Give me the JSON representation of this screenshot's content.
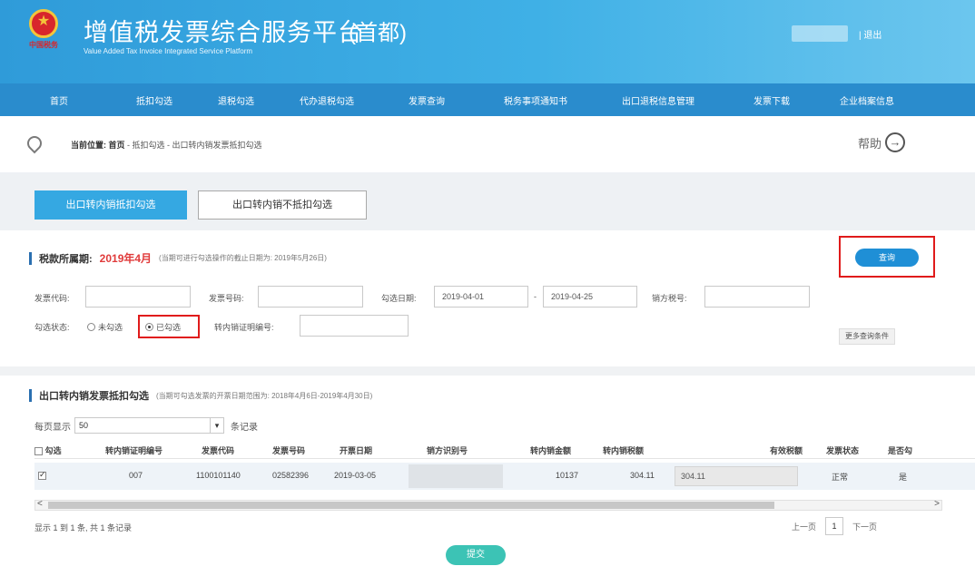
{
  "header": {
    "title": "增值税发票综合服务平台",
    "subtitle": "Value Added Tax Invoice Integrated Service Platform",
    "region": "(首都)",
    "logout": "| 退出",
    "emblem_caption": "中国税务"
  },
  "nav": {
    "items": [
      {
        "label": "首页"
      },
      {
        "label": "抵扣勾选"
      },
      {
        "label": "退税勾选"
      },
      {
        "label": "代办退税勾选"
      },
      {
        "label": "发票查询"
      },
      {
        "label": "税务事项通知书"
      },
      {
        "label": "出口退税信息管理"
      },
      {
        "label": "发票下载"
      },
      {
        "label": "企业档案信息"
      }
    ]
  },
  "breadcrumb": {
    "prefix": "当前位置:",
    "home": "首页",
    "path": " - 抵扣勾选 - 出口转内销发票抵扣勾选"
  },
  "help": {
    "label": "帮助",
    "arrow": "→"
  },
  "tabs": {
    "active": "出口转内销抵扣勾选",
    "inactive": "出口转内销不抵扣勾选"
  },
  "filter": {
    "period_label": "税款所属期:",
    "period_value": "2019年4月",
    "period_hint": "(当期可进行勾选操作的截止日期为: 2019年5月26日)",
    "query_button": "查询",
    "invoice_code_label": "发票代码:",
    "invoice_code_value": "",
    "invoice_no_label": "发票号码:",
    "invoice_no_value": "",
    "select_date_label": "勾选日期:",
    "date_from": "2019-04-01",
    "date_sep": "-",
    "date_to": "2019-04-25",
    "seller_tax_label": "销方税号:",
    "seller_tax_value": "",
    "status_label": "勾选状态:",
    "status_unselected": "未勾选",
    "status_selected": "已勾选",
    "cert_no_label": "转内销证明编号:",
    "cert_no_value": "",
    "more_conditions": "更多查询条件"
  },
  "results": {
    "title": "出口转内销发票抵扣勾选",
    "hint": "(当期可勾选发票的开票日期范围为: 2018年4月6日-2019年4月30日)",
    "per_page_label": "每页显示",
    "per_page_value": "50",
    "per_page_suffix": "条记录",
    "columns": [
      "勾选",
      "转内销证明编号",
      "发票代码",
      "发票号码",
      "开票日期",
      "销方识别号",
      "转内销金额",
      "转内销税额",
      "有效税额",
      "发票状态",
      "是否勾"
    ],
    "rows": [
      {
        "checked": true,
        "cert_no": "007",
        "invoice_code": "1100101140",
        "invoice_no": "02582396",
        "issue_date": "2019-03-05",
        "seller_id": "",
        "amount": "10137",
        "tax": "304.11",
        "valid_tax": "304.11",
        "status": "正常",
        "is_selected": "是"
      }
    ],
    "summary": "显示 1 到 1 条, 共 1 条记录",
    "pager_prev": "上一页",
    "pager_current": "1",
    "pager_next": "下一页",
    "scroll_left": "<",
    "scroll_right": ">"
  },
  "submit": {
    "label": "提交"
  },
  "colors": {
    "header_blue": "#3fb0e6",
    "nav_blue": "#2a8ccd",
    "tab_active": "#35a8e2",
    "query_button": "#1f8fd6",
    "highlight_red": "#e01b1b",
    "period_red": "#e03b3b",
    "submit_teal": "#3cc3b5"
  }
}
